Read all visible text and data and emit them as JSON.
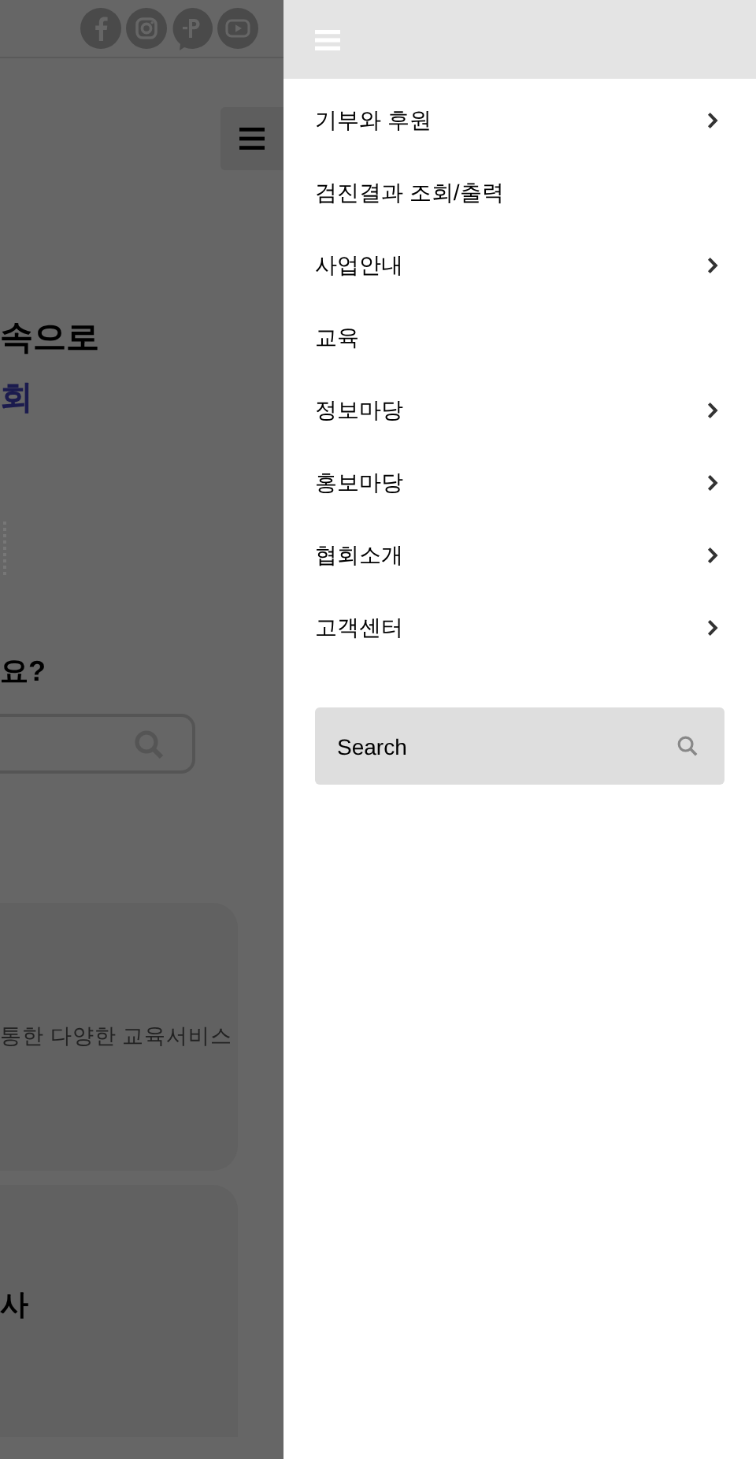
{
  "background_page": {
    "heading_line_1": "속으로",
    "heading_line_2": "회",
    "question": "요?",
    "card_1_text": "통한 다양한 교육서비스",
    "card_2_title": "사"
  },
  "menu": {
    "items": [
      {
        "label": "기부와 후원",
        "expandable": true
      },
      {
        "label": "검진결과 조회/출력",
        "expandable": false
      },
      {
        "label": "사업안내",
        "expandable": true
      },
      {
        "label": "교육",
        "expandable": false
      },
      {
        "label": "정보마당",
        "expandable": true
      },
      {
        "label": "홍보마당",
        "expandable": true
      },
      {
        "label": "협회소개",
        "expandable": true
      },
      {
        "label": "고객센터",
        "expandable": true
      }
    ],
    "search": {
      "placeholder": "Search"
    }
  }
}
